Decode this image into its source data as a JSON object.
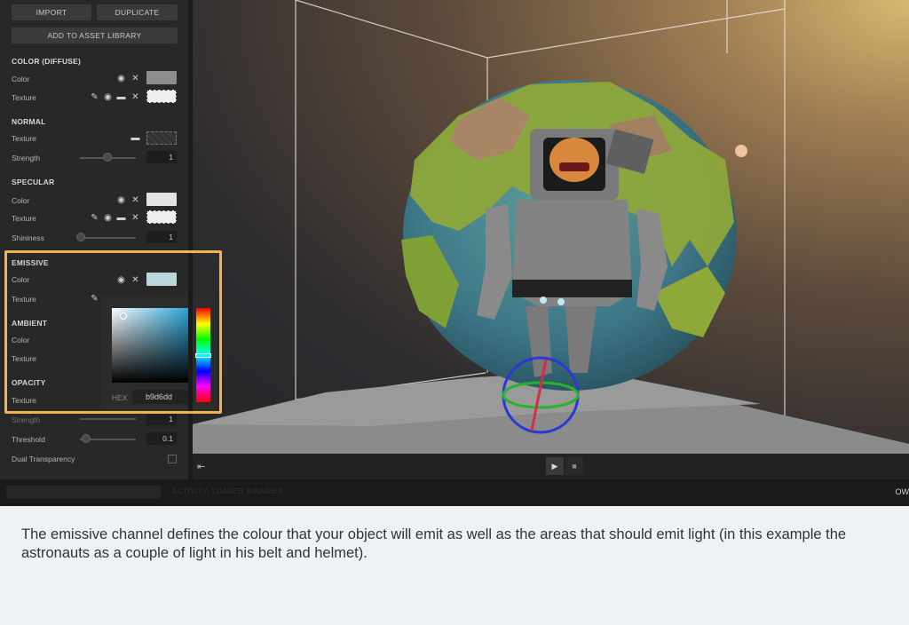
{
  "panel": {
    "buttons": {
      "import": "IMPORT",
      "duplicate": "DUPLICATE",
      "add_to_library": "ADD TO ASSET LIBRARY"
    },
    "sections": {
      "diffuse": {
        "title": "COLOR (DIFFUSE)",
        "color": "Color",
        "texture": "Texture",
        "swatch": "#8e8e8e"
      },
      "normal": {
        "title": "NORMAL",
        "texture": "Texture",
        "strength": "Strength",
        "strength_value": "1",
        "strength_level": 0.5
      },
      "specular": {
        "title": "SPECULAR",
        "color": "Color",
        "texture": "Texture",
        "shininess": "Shininess",
        "shininess_value": "1",
        "shininess_level": 0.0,
        "swatch": "#e3e3e3"
      },
      "emissive": {
        "title": "EMISSIVE",
        "color": "Color",
        "texture": "Texture",
        "swatch": "#b9d6dd"
      },
      "ambient": {
        "title": "AMBIENT",
        "color": "Color",
        "texture": "Texture"
      },
      "opacity": {
        "title": "OPACITY",
        "texture": "Texture",
        "strength": "Strength",
        "strength_value": "1",
        "threshold": "Threshold",
        "threshold_value": "0.1",
        "threshold_level": 0.1,
        "dual_transparency": "Dual Transparency"
      }
    },
    "color_picker": {
      "hex_label": "HEX",
      "hex_value": "b9d6dd"
    }
  },
  "status": {
    "text": "ACTIVITY: LOADED BINARIES",
    "right": "OW"
  },
  "caption": "The emissive channel defines the colour that your object will emit as well as the areas that should emit light (in this example the astronauts as a couple of light in his belt and helmet).",
  "colors": {
    "highlight": "#f3b44d",
    "panel_bg": "#282828",
    "emissive": "#b9d6dd"
  },
  "icons": [
    "eye-icon",
    "close-icon",
    "pencil-icon",
    "folder-icon",
    "play-icon",
    "stop-icon",
    "exit-icon"
  ]
}
